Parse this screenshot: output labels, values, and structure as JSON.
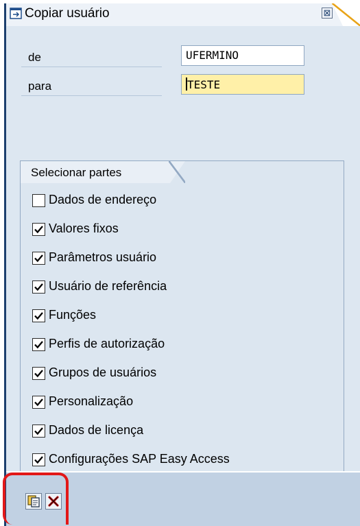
{
  "dialog": {
    "title": "Copiar usuário",
    "close_glyph": "⊠",
    "icon": "window-icon"
  },
  "fields": [
    {
      "label": "de",
      "value": "UFERMINO"
    },
    {
      "label": "para",
      "value": "TESTE"
    }
  ],
  "group": {
    "title": "Selecionar partes",
    "items": [
      {
        "label": "Dados de endereço",
        "checked": false
      },
      {
        "label": "Valores fixos",
        "checked": true
      },
      {
        "label": "Parâmetros usuário",
        "checked": true
      },
      {
        "label": "Usuário de referência",
        "checked": true
      },
      {
        "label": "Funções",
        "checked": true
      },
      {
        "label": "Perfis de autorização",
        "checked": true
      },
      {
        "label": "Grupos de usuários",
        "checked": true
      },
      {
        "label": "Personalização",
        "checked": true
      },
      {
        "label": "Dados de licença",
        "checked": true
      },
      {
        "label": "Configurações SAP Easy Access",
        "checked": true
      }
    ]
  },
  "footer": {
    "buttons": [
      {
        "icon": "copy-icon"
      },
      {
        "icon": "cancel-icon"
      }
    ]
  },
  "colors": {
    "title_accent": "#1c3f6e",
    "highlight": "#e21818",
    "active_input": "#fff0a8"
  }
}
